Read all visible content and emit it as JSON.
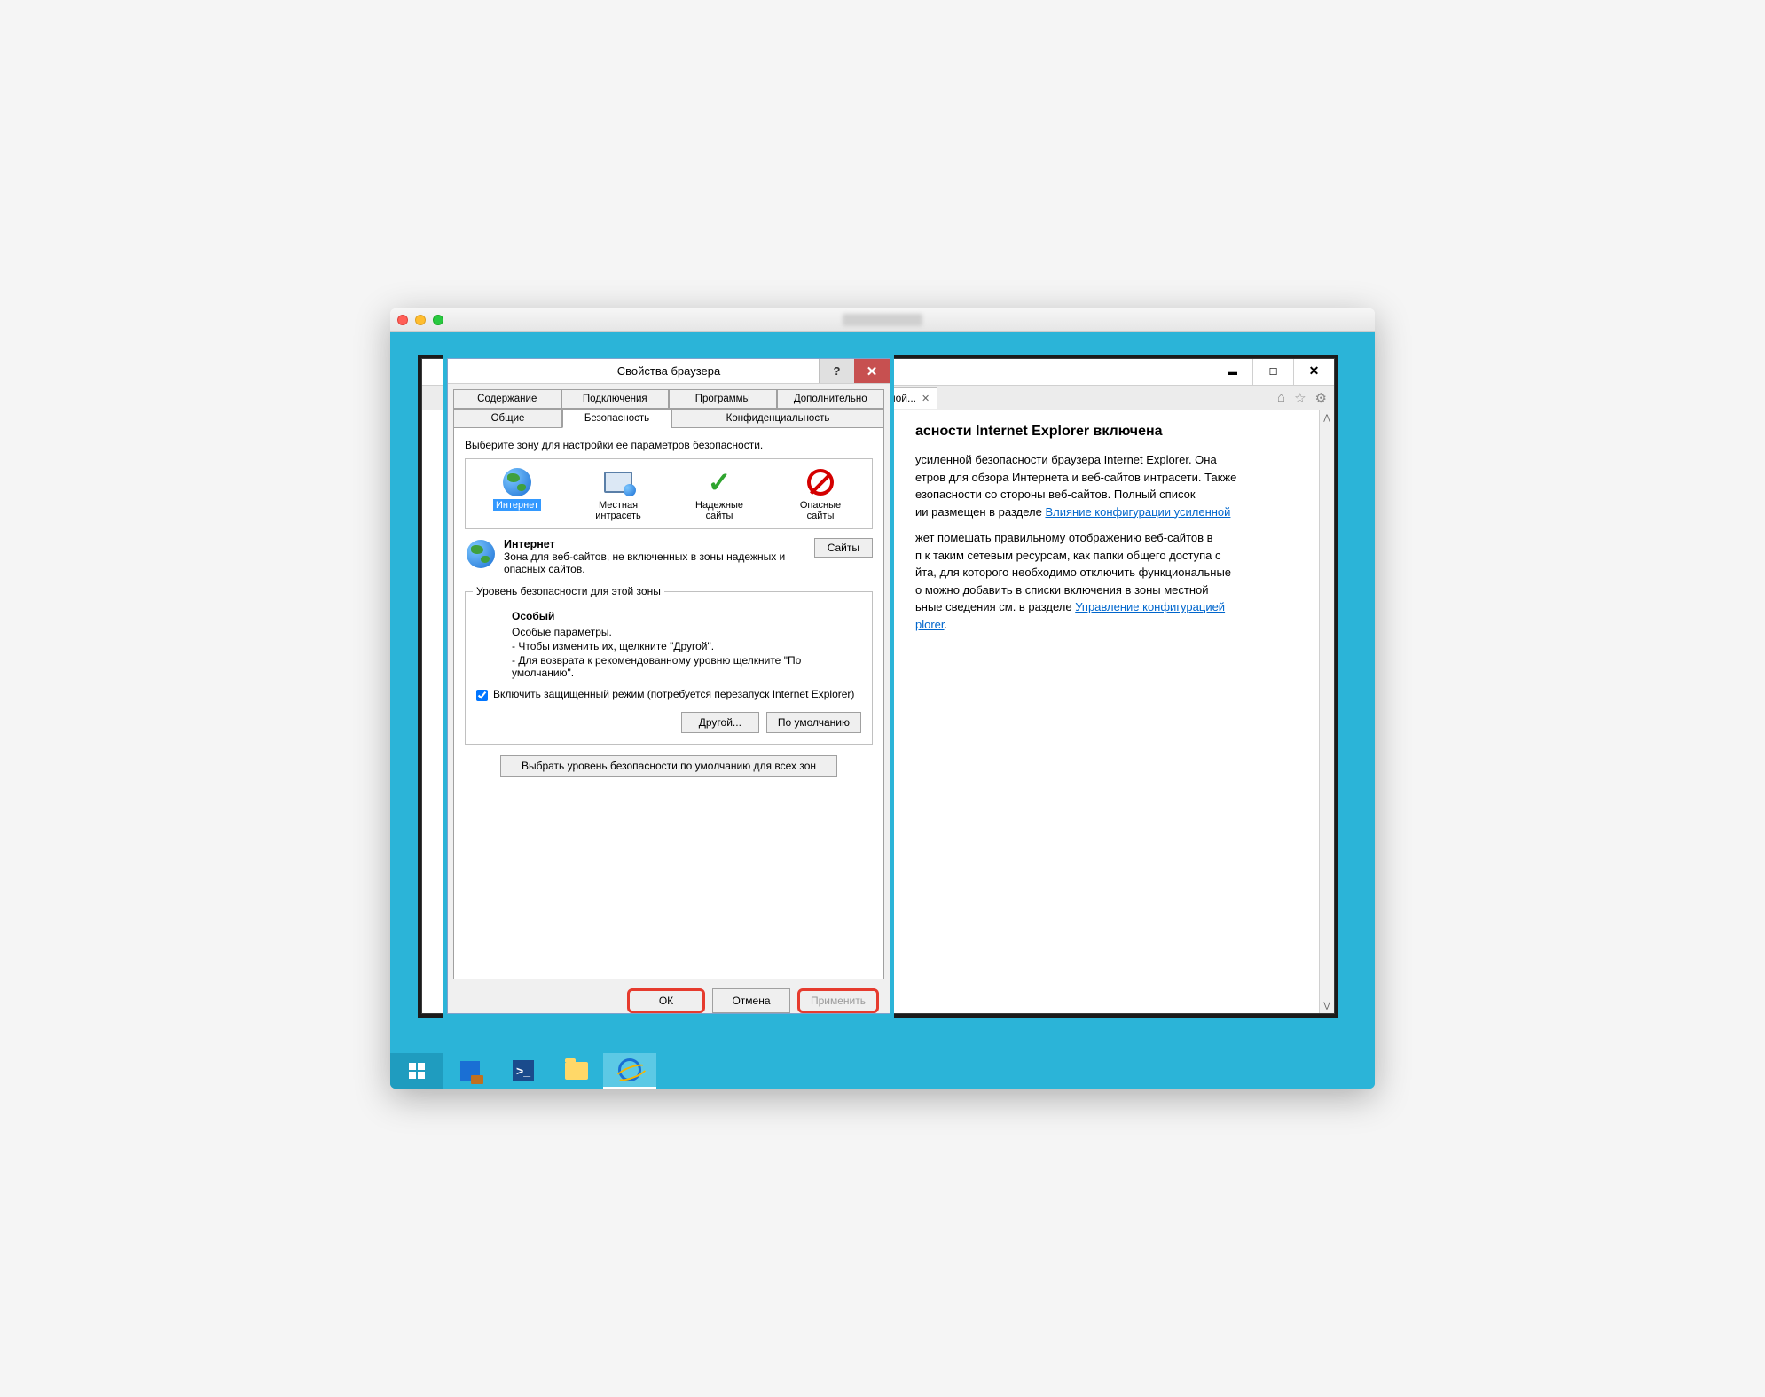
{
  "dialog": {
    "title": "Свойства браузера",
    "tabs_row1": [
      "Содержание",
      "Подключения",
      "Программы",
      "Дополнительно"
    ],
    "tabs_row2": [
      "Общие",
      "Безопасность",
      "Конфиденциальность"
    ],
    "active_tab": "Безопасность",
    "zone_prompt": "Выберите зону для настройки ее параметров безопасности.",
    "zones": [
      {
        "label": "Интернет",
        "sub": ""
      },
      {
        "label": "Местная",
        "sub": "интрасеть"
      },
      {
        "label": "Надежные",
        "sub": "сайты"
      },
      {
        "label": "Опасные",
        "sub": "сайты"
      }
    ],
    "selected_zone_title": "Интернет",
    "selected_zone_desc": "Зона для веб-сайтов, не включенных в зоны надежных и опасных сайтов.",
    "sites_btn": "Сайты",
    "level_legend": "Уровень безопасности для этой зоны",
    "level_title": "Особый",
    "level_line1": "Особые параметры.",
    "level_line2": "- Чтобы изменить их, щелкните \"Другой\".",
    "level_line3": "- Для возврата к рекомендованному уровню щелкните \"По умолчанию\".",
    "protected_mode": "Включить защищенный режим (потребуется перезапуск Internet Explorer)",
    "protected_mode_checked": true,
    "other_btn": "Другой...",
    "default_btn": "По умолчанию",
    "reset_btn": "Выбрать уровень безопасности по умолчанию для всех зон",
    "ok": "ОК",
    "cancel": "Отмена",
    "apply": "Применить"
  },
  "ie": {
    "tab_label": "ной...",
    "heading": "асности Internet Explorer включена",
    "p1a": "усиленной безопасности браузера Internet Explorer. Она",
    "p1b": "етров для обзора Интернета и веб-сайтов интрасети. Также",
    "p1c": "езопасности со стороны веб-сайтов. Полный список",
    "p1d": "ии размещен в разделе ",
    "link1": "Влияние конфигурации усиленной",
    "p2a": "жет помешать правильному отображению веб-сайтов в",
    "p2b": "п к таким сетевым ресурсам, как папки общего доступа с",
    "p2c": "йта, для которого необходимо отключить функциональные",
    "p2d": "о можно добавить в списки включения в зоны местной",
    "p2e": "ьные сведения см. в разделе ",
    "link2": "Управление конфигурацией",
    "link2b": "plorer"
  }
}
